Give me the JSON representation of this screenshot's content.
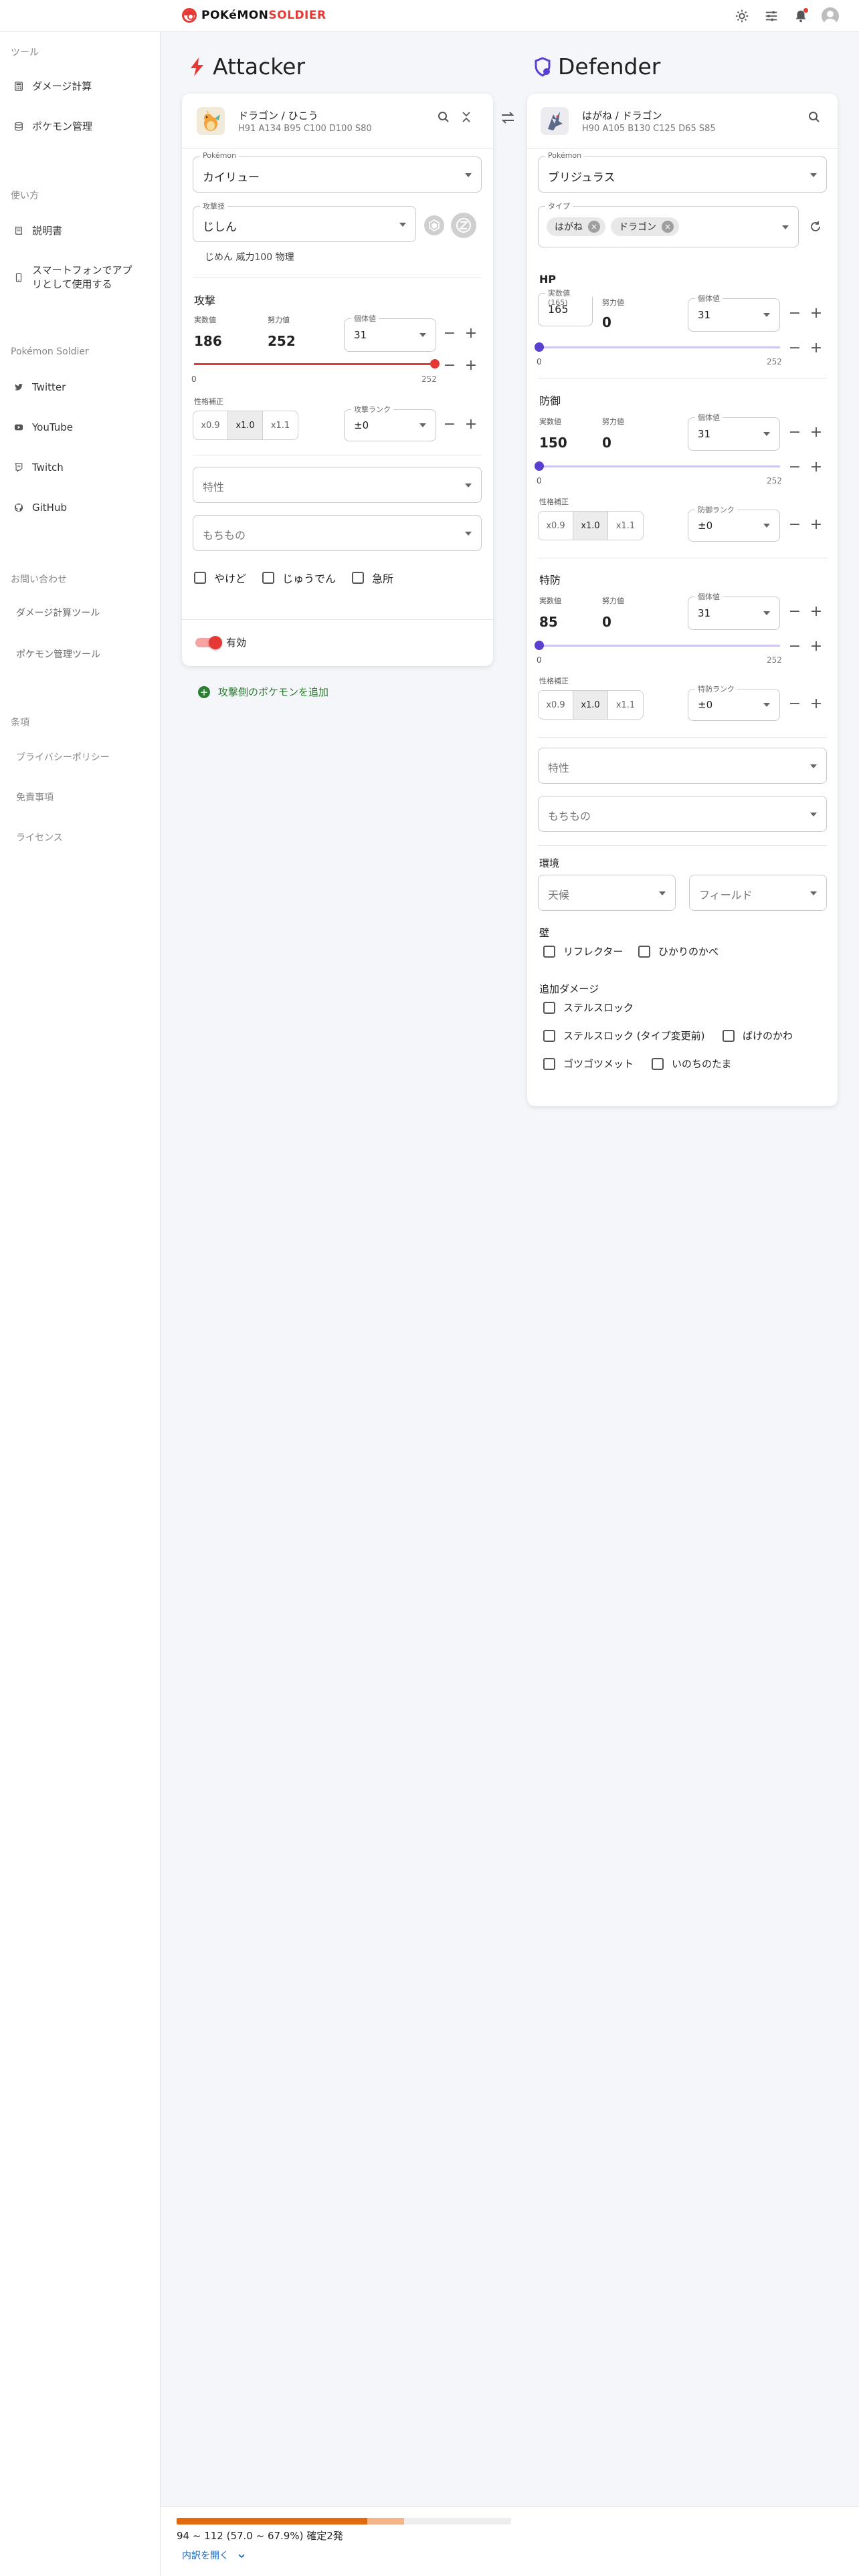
{
  "header": {
    "logo_part1": "POKéMON",
    "logo_part2": "SOLDIER",
    "icons": [
      "sun-icon",
      "tune-icon",
      "bell-icon",
      "account-icon"
    ]
  },
  "sidebar": {
    "sections": {
      "tools": "ツール",
      "usage": "使い方",
      "soldier": "Pokémon Soldier",
      "contact": "お問い合わせ",
      "terms": "条項"
    },
    "tools": [
      {
        "label": "ダメージ計算",
        "icon": "calculator-icon"
      },
      {
        "label": "ポケモン管理",
        "icon": "database-icon"
      }
    ],
    "usage": [
      {
        "label": "説明書",
        "icon": "book-icon"
      },
      {
        "label_line1": "スマートフォンでアプ",
        "label_line2": "リとして使用する",
        "icon": "phone-icon"
      }
    ],
    "soldier": [
      {
        "label": "Twitter",
        "icon": "twitter-icon"
      },
      {
        "label": "YouTube",
        "icon": "youtube-icon"
      },
      {
        "label": "Twitch",
        "icon": "twitch-icon"
      },
      {
        "label": "GitHub",
        "icon": "github-icon"
      }
    ],
    "contact": [
      {
        "label": "ダメージ計算ツール"
      },
      {
        "label": "ポケモン管理ツール"
      }
    ],
    "terms": [
      {
        "label": "プライバシーポリシー"
      },
      {
        "label": "免責事項"
      },
      {
        "label": "ライセンス"
      }
    ]
  },
  "attacker": {
    "title": "Attacker",
    "types": "ドラゴン / ひこう",
    "base_stats": "H91 A134 B95 C100 D100 S80",
    "pokemon_label": "Pokémon",
    "pokemon": "カイリュー",
    "move_label": "攻撃技",
    "move": "じしん",
    "move_info": "じめん 威力100 物理",
    "stat_section": "攻撃",
    "actual_label": "実数値",
    "actual": "186",
    "ev_label": "努力値",
    "ev": "252",
    "iv_label": "個体値",
    "iv": "31",
    "ev_fraction": 1.0,
    "slider_min": "0",
    "slider_max": "252",
    "nature_label": "性格補正",
    "nature_options": [
      "x0.9",
      "x1.0",
      "x1.1"
    ],
    "nature_selected": "x1.0",
    "rank_label": "攻撃ランク",
    "rank": "±0",
    "ability_placeholder": "特性",
    "item_placeholder": "もちもの",
    "checkboxes": [
      "やけど",
      "じゅうでん",
      "急所"
    ],
    "toggle_label": "有効",
    "add_label": "攻撃側のポケモンを追加"
  },
  "defender": {
    "title": "Defender",
    "types": "はがね / ドラゴン",
    "base_stats": "H90 A105 B130 C125 D65 S85",
    "pokemon_label": "Pokémon",
    "pokemon": "ブリジュラス",
    "type_label": "タイプ",
    "type_chips": [
      "はがね",
      "ドラゴン"
    ],
    "stats": [
      {
        "section": "HP",
        "actual_label": "実数値(165)",
        "actual": "165",
        "ev_label": "努力値",
        "ev": "0",
        "iv_label": "個体値",
        "iv": "31",
        "ev_fraction": 0.0,
        "min": "0",
        "max": "252"
      },
      {
        "section": "防御",
        "actual_label": "実数値",
        "actual": "150",
        "ev_label": "努力値",
        "ev": "0",
        "iv_label": "個体値",
        "iv": "31",
        "ev_fraction": 0.0,
        "min": "0",
        "max": "252",
        "nature_label": "性格補正",
        "rank_label": "防御ランク",
        "rank": "±0"
      },
      {
        "section": "特防",
        "actual_label": "実数値",
        "actual": "85",
        "ev_label": "努力値",
        "ev": "0",
        "iv_label": "個体値",
        "iv": "31",
        "ev_fraction": 0.0,
        "min": "0",
        "max": "252",
        "nature_label": "性格補正",
        "rank_label": "特防ランク",
        "rank": "±0"
      }
    ],
    "nature_options": [
      "x0.9",
      "x1.0",
      "x1.1"
    ],
    "nature_selected": "x1.0",
    "ability_placeholder": "特性",
    "item_placeholder": "もちもの",
    "env_section": "環境",
    "weather_placeholder": "天候",
    "field_placeholder": "フィールド",
    "wall_section": "壁",
    "walls": [
      "リフレクター",
      "ひかりのかべ"
    ],
    "extra_section": "追加ダメージ",
    "extras": [
      "ステルスロック",
      "ステルスロック (タイプ変更前)",
      "ばけのかわ",
      "ゴツゴツメット",
      "いのちのたま"
    ]
  },
  "result": {
    "damage_text": "94 ~ 112 (57.0 ~ 67.9%) 確定2発",
    "min_percent": 57.0,
    "max_percent": 67.9,
    "detail_link": "内訳を開く"
  },
  "colors": {
    "attacker_accent": "#e53935",
    "defender_accent": "#5b3fd1",
    "damage_min": "#e06a0d",
    "damage_max": "#f3b587",
    "link": "#1565c0",
    "add": "#2e7d32"
  }
}
